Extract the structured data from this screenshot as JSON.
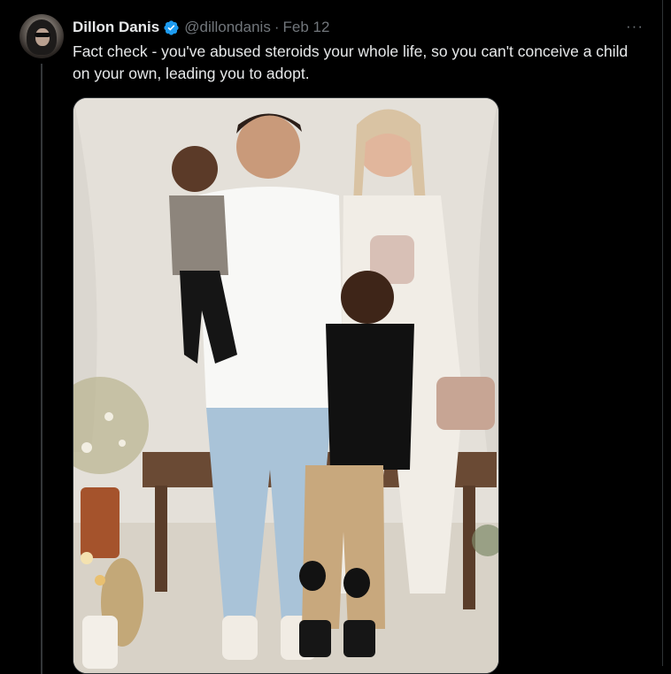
{
  "tweet": {
    "author_name": "Dillon Danis",
    "handle": "@dillondanis",
    "separator": "·",
    "date": "Feb 12",
    "more_label": "···",
    "text": "Fact check - you've abused steroids your whole life, so you can't conceive a child on your own, leading you to adopt."
  },
  "icons": {
    "verified": "verified-badge-icon",
    "more": "more-options-icon"
  },
  "colors": {
    "background": "#000000",
    "text_primary": "#e7e9ea",
    "text_secondary": "#71767b",
    "verified_blue": "#1d9bf0",
    "border": "#2f3336"
  },
  "media": {
    "type": "photo",
    "subject": "family photo"
  }
}
